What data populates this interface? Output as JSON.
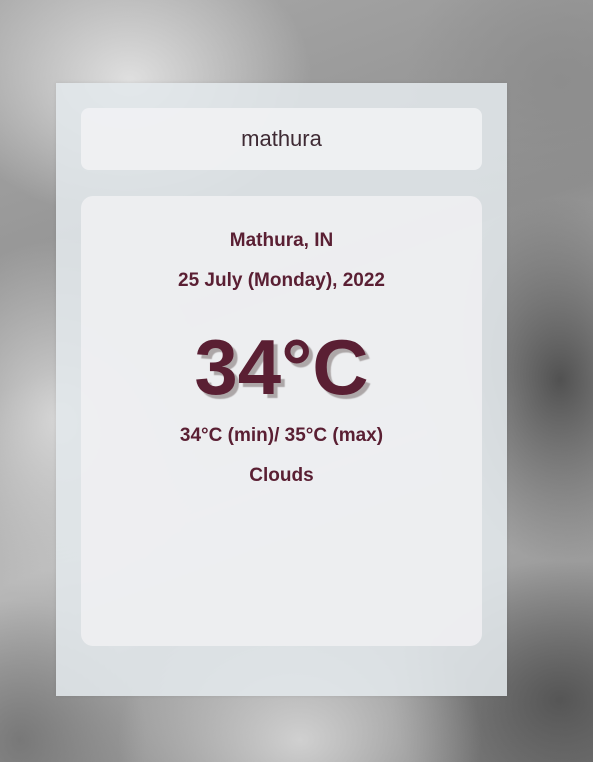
{
  "search": {
    "value": "mathura"
  },
  "weather": {
    "location": "Mathura, IN",
    "date": "25 July (Monday), 2022",
    "temperature": "34°C",
    "min_max": "34°C (min)/ 35°C (max)",
    "condition": "Clouds"
  },
  "colors": {
    "text_primary": "#5a1f33",
    "search_text": "#3e2a34",
    "panel_background": "#e2e8ec"
  }
}
